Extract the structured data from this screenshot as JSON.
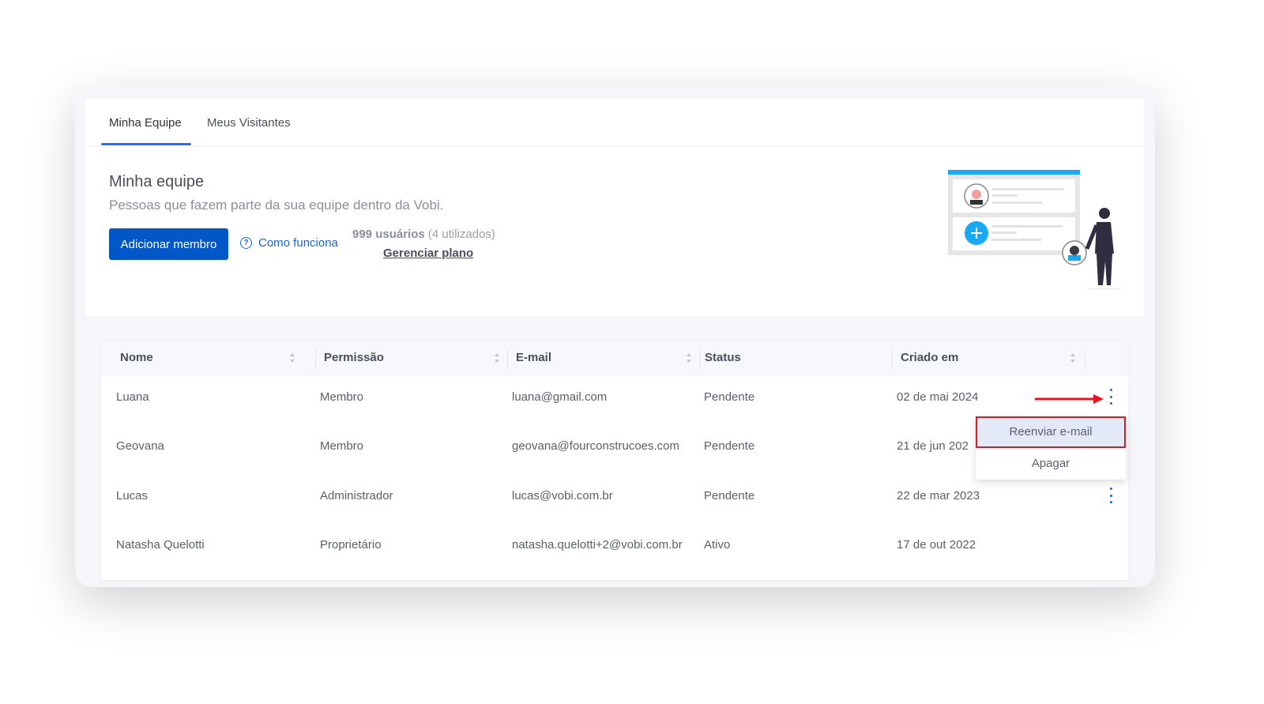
{
  "tabs": [
    {
      "label": "Minha Equipe",
      "active": true
    },
    {
      "label": "Meus Visitantes",
      "active": false
    }
  ],
  "header": {
    "title": "Minha equipe",
    "subtitle": "Pessoas que fazem parte da sua equipe dentro da Vobi.",
    "add_button": "Adicionar membro",
    "how_link": "Como funciona",
    "how_icon": "question-circle-icon",
    "users_count": "999 usuários",
    "users_used": "(4 utilizados)",
    "manage_plan": "Gerenciar plano"
  },
  "accent": "#0057c8",
  "table": {
    "columns": [
      "Nome",
      "Permissão",
      "E-mail",
      "Status",
      "Criado em"
    ],
    "rows": [
      {
        "name": "Luana",
        "permission": "Membro",
        "email": "luana@gmail.com",
        "status": "Pendente",
        "created": "02 de mai 2024"
      },
      {
        "name": "Geovana",
        "permission": "Membro",
        "email": "geovana@fourconstrucoes.com",
        "status": "Pendente",
        "created": "21 de jun 202"
      },
      {
        "name": "Lucas",
        "permission": "Administrador",
        "email": "lucas@vobi.com.br",
        "status": "Pendente",
        "created": "22 de mar 2023"
      },
      {
        "name": "Natasha Quelotti",
        "permission": "Proprietário",
        "email": "natasha.quelotti+2@vobi.com.br",
        "status": "Ativo",
        "created": "17 de out 2022"
      }
    ]
  },
  "row_menu": {
    "items": [
      "Reenviar e-mail",
      "Apagar"
    ],
    "highlighted": "Reenviar e-mail"
  }
}
